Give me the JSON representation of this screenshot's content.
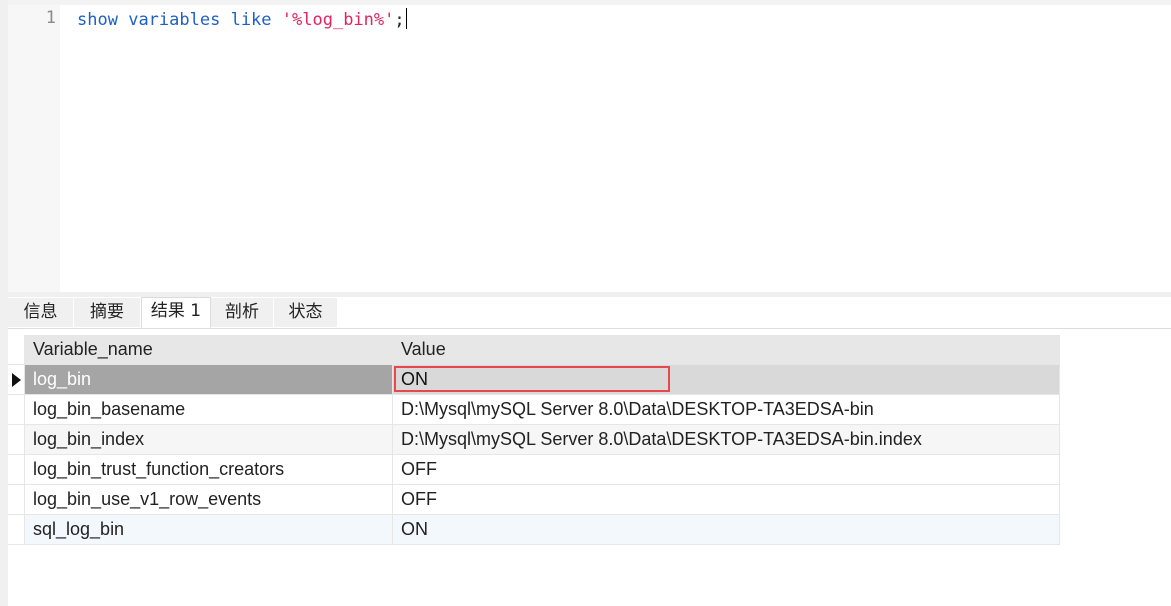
{
  "editor": {
    "line_number": "1",
    "code": {
      "kw1": "show",
      "kw2": "variables",
      "kw3": "like",
      "str": "'%log_bin%'",
      "end": ";"
    }
  },
  "tabs": [
    {
      "label": "信息"
    },
    {
      "label": "摘要"
    },
    {
      "label": "结果 1"
    },
    {
      "label": "剖析"
    },
    {
      "label": "状态"
    }
  ],
  "active_tab": "结果 1",
  "grid": {
    "columns": [
      "Variable_name",
      "Value"
    ],
    "rows": [
      {
        "name": "log_bin",
        "value": "ON"
      },
      {
        "name": "log_bin_basename",
        "value": "D:\\Mysql\\mySQL Server 8.0\\Data\\DESKTOP-TA3EDSA-bin"
      },
      {
        "name": "log_bin_index",
        "value": "D:\\Mysql\\mySQL Server 8.0\\Data\\DESKTOP-TA3EDSA-bin.index"
      },
      {
        "name": "log_bin_trust_function_creators",
        "value": "OFF"
      },
      {
        "name": "log_bin_use_v1_row_events",
        "value": "OFF"
      },
      {
        "name": "sql_log_bin",
        "value": "ON"
      }
    ]
  },
  "colors": {
    "keyword": "#1f5fc8",
    "string": "#e0245e",
    "highlight": "#e5484d",
    "selected_row": "#a5a5a5"
  },
  "icons": {
    "row_indicator": "current-row-arrow-icon"
  }
}
